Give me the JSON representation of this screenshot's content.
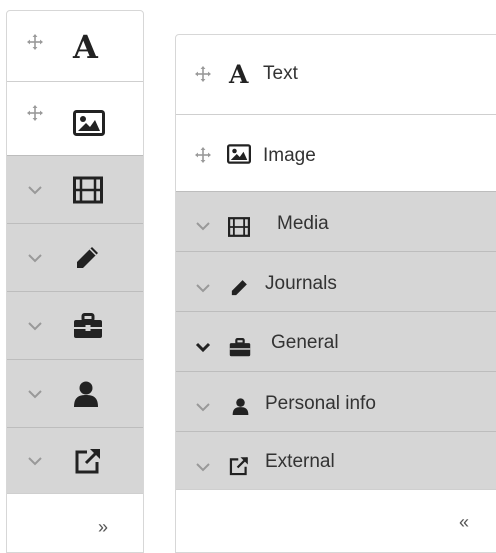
{
  "colors": {
    "border": "#d7d7d7",
    "group_background": "#d6d6d6",
    "text": "#333333",
    "icon_dark": "#222222",
    "handle": "#9a9a9a"
  },
  "collapsed_panel": {
    "items": [
      {
        "kind": "handle",
        "icon": "text-icon",
        "glyph": "A"
      },
      {
        "kind": "handle",
        "icon": "image-icon"
      },
      {
        "kind": "group",
        "icon": "film-icon",
        "expanded": false
      },
      {
        "kind": "group",
        "icon": "pencil-icon",
        "expanded": false
      },
      {
        "kind": "group",
        "icon": "briefcase-icon",
        "expanded": false
      },
      {
        "kind": "group",
        "icon": "user-icon",
        "expanded": false
      },
      {
        "kind": "group",
        "icon": "external-link-icon",
        "expanded": false
      }
    ],
    "toggle": {
      "icon": "expand-icon",
      "glyph": "»"
    }
  },
  "expanded_panel": {
    "items": [
      {
        "kind": "handle",
        "icon": "text-icon",
        "glyph": "A",
        "label": "Text"
      },
      {
        "kind": "handle",
        "icon": "image-icon",
        "label": "Image"
      },
      {
        "kind": "group",
        "icon": "film-icon",
        "label": "Media",
        "expanded": false
      },
      {
        "kind": "group",
        "icon": "pencil-icon",
        "label": "Journals",
        "expanded": false
      },
      {
        "kind": "group",
        "icon": "briefcase-icon",
        "label": "General",
        "expanded": true
      },
      {
        "kind": "group",
        "icon": "user-icon",
        "label": "Personal info",
        "expanded": false
      },
      {
        "kind": "group",
        "icon": "external-link-icon",
        "label": "External",
        "expanded": false
      }
    ],
    "toggle": {
      "icon": "collapse-icon",
      "glyph": "«"
    }
  }
}
